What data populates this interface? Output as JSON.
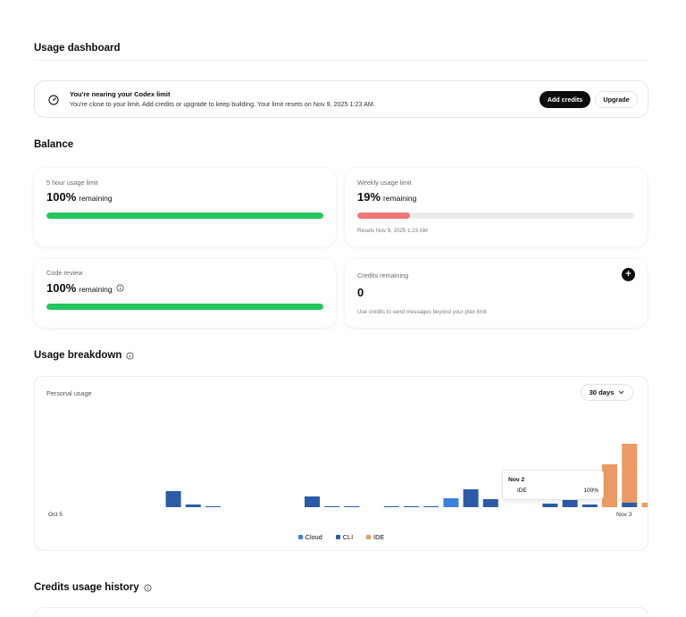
{
  "page": {
    "title": "Usage dashboard"
  },
  "alert": {
    "icon": "gauge-icon",
    "title": "You're nearing your Codex limit",
    "text": "You're close to your limit. Add credits or upgrade to keep building. Your limit resets on Nov 9, 2025 1:23 AM.",
    "add_credits_label": "Add credits",
    "upgrade_label": "Upgrade"
  },
  "balance": {
    "title": "Balance",
    "five_hour": {
      "label": "5 hour usage limit",
      "percent": "100%",
      "suffix": "remaining",
      "fill_fraction": 1.0,
      "color": "#22c55e"
    },
    "weekly": {
      "label": "Weekly usage limit",
      "percent": "19%",
      "suffix": "remaining",
      "fill_fraction": 0.19,
      "color": "#ef7676",
      "note": "Resets Nov 9, 2025 1:23 AM"
    },
    "code_review": {
      "label": "Code review",
      "percent": "100%",
      "suffix": "remaining",
      "fill_fraction": 1.0,
      "color": "#22c55e"
    },
    "credits": {
      "label": "Credits remaining",
      "value": "0",
      "note": "Use credits to send messages beyond your plan limit",
      "add_icon": "plus-icon",
      "add_symbol": "+"
    }
  },
  "breakdown": {
    "title": "Usage breakdown",
    "subtitle": "Personal usage",
    "range_label": "30 days",
    "x_start": "Oct 5",
    "x_end": "Nov 3",
    "tooltip": {
      "date": "Nov 2",
      "series": "IDE",
      "value": "100%"
    },
    "legend": [
      {
        "name": "Cloud",
        "color": "#3b82e0"
      },
      {
        "name": "CLI",
        "color": "#2b5ba7"
      },
      {
        "name": "IDE",
        "color": "#ec9a63"
      }
    ]
  },
  "chart_data": {
    "type": "bar",
    "categories": [
      "Oct 5",
      "Oct 6",
      "Oct 7",
      "Oct 8",
      "Oct 9",
      "Oct 10",
      "Oct 11",
      "Oct 12",
      "Oct 13",
      "Oct 14",
      "Oct 15",
      "Oct 16",
      "Oct 17",
      "Oct 18",
      "Oct 19",
      "Oct 20",
      "Oct 21",
      "Oct 22",
      "Oct 23",
      "Oct 24",
      "Oct 25",
      "Oct 26",
      "Oct 27",
      "Oct 28",
      "Oct 29",
      "Oct 30",
      "Oct 31",
      "Nov 1",
      "Nov 2",
      "Nov 3"
    ],
    "series": [
      {
        "name": "Cloud",
        "values": [
          0,
          0,
          0,
          0,
          0,
          0,
          0,
          0,
          0,
          0,
          0,
          0,
          0,
          0,
          0,
          0,
          0,
          10,
          0,
          0,
          0,
          0,
          0,
          0,
          0,
          0,
          0,
          0,
          0,
          0
        ]
      },
      {
        "name": "CLI",
        "values": [
          0,
          0,
          0,
          18,
          3,
          0.5,
          0,
          0,
          0,
          0,
          12,
          0.5,
          0.5,
          0,
          0.5,
          0.5,
          0.5,
          0,
          20,
          9,
          0,
          0,
          4,
          8,
          3,
          0,
          5,
          0,
          0,
          0
        ]
      },
      {
        "name": "IDE",
        "values": [
          0,
          0,
          0,
          0,
          0,
          0,
          0,
          0,
          0,
          0,
          0,
          0,
          0,
          0,
          0,
          0,
          0,
          0,
          0,
          0,
          0,
          0,
          0,
          0,
          0,
          48,
          66,
          5,
          100,
          0
        ]
      }
    ],
    "stacked": true,
    "xlabel": "",
    "ylabel": "",
    "ylim": [
      0,
      100
    ],
    "grid": false,
    "legend_position": "bottom"
  },
  "history": {
    "title": "Credits usage history"
  }
}
